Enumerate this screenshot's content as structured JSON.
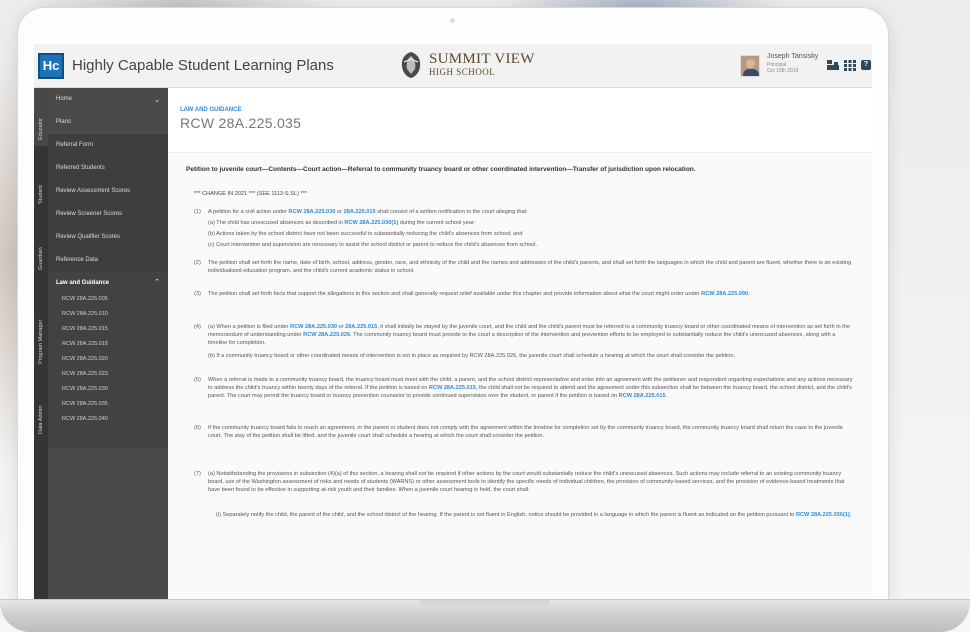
{
  "header": {
    "logo_text": "Hc",
    "app_title": "Highly Capable Student Learning Plans",
    "school_name": "SUMMIT VIEW",
    "school_sub": "HIGH SCHOOL",
    "user_name": "Joseph Tansisky",
    "user_role": "Principal",
    "user_date": "Oct 16th 2019"
  },
  "roles": [
    "Educator",
    "Student",
    "Guardian",
    "Program Manager",
    "Data Admin"
  ],
  "nav": {
    "items": [
      "Home",
      "Plans",
      "Referral Form",
      "Referred Students",
      "Review Assessment Scores",
      "Review Screener Scores",
      "Review Qualifier Scores",
      "Reference Data"
    ],
    "group_title": "Law and Guidance",
    "group_items": [
      "RCW 28A.225.005",
      "RCW 28A.225.010",
      "RCW 28A.225.015",
      "RCW 28A.225.018",
      "RCW 28A.225.020",
      "RCW 28A.225.023",
      "RCW 28A.225.030",
      "RCW 28A.225.035",
      "RCW 28A.225.040"
    ]
  },
  "content": {
    "category": "LAW AND GUIDANCE",
    "title": "RCW 28A.225.035",
    "heading": "Petition to juvenile court—Contents—Court action—Referral to community truancy board or other coordinated intervention—Transfer of jurisdiction upon relocation.",
    "change_note": "*** CHANGE IN 2021 *** (SEE 1113-S.SL) ***",
    "p1": {
      "num": "(1)",
      "a": "A petition for a civil action under ",
      "ref1": "RCW 28A.225.030",
      "b": " or ",
      "ref2": "28A.225.015",
      "c": " shall consist of a written notification to the court alleging that:",
      "sa_a": "(a) The child has unexcused absences as described in ",
      "sa_ref": "RCW 28A.225.030(1)",
      "sa_b": " during the current school year;",
      "sb": "(b) Actions taken by the school district have not been successful in substantially reducing the child's absences from school; and",
      "sc": "(c) Court intervention and supervision are necessary to assist the school district or parent to reduce the child's absences from school."
    },
    "p2": {
      "num": "(2)",
      "text": "The petition shall set forth the name, date of birth, school, address, gender, race, and ethnicity of the child and the names and addresses of the child's parents, and shall set forth the languages in which the child and parent are fluent, whether there is an existing individualized education program, and the child's current academic status in school."
    },
    "p3": {
      "num": "(3)",
      "a": "The petition shall set forth facts that support the allegations in this section and shall generally request relief available under this chapter and provide information about what the court might order under ",
      "ref": "RCW 28A.225.090",
      "b": "."
    },
    "p4": {
      "num": "(4)",
      "a": "(a) When a petition is filed under ",
      "ref1": "RCW 28A.225.030",
      "b": " or ",
      "ref2": "28A.225.015",
      "c": ", it shall initially be stayed by the juvenile court, and the child and the child's parent must be referred to a community truancy board or other coordinated means of intervention as set forth in the memorandum of understanding under ",
      "ref3": "RCW 28A.225.026",
      "d": ". The community truancy board must provide to the court a description of the intervention and prevention efforts to be employed to substantially reduce the child's unexcused absences, along with a timeline for completion.",
      "sb": "(b) If a community truancy board or other coordinated means of intervention is not in place as required by RCW 28A.225.026, the juvenile court shall schedule a hearing at which the court shall consider the petition."
    },
    "p5": {
      "num": "(5)",
      "a": "When a referral is made to a community truancy board, the truancy board must meet with the child, a parent, and the school district representative and enter into an agreement with the petitioner and respondent regarding expectations and any actions necessary to address the child's truancy within twenty days of the referral. If the petition is based on ",
      "ref1": "RCW 28A.225.015",
      "b": ", the child shall not be required to attend and the agreement under this subsection shall be between the truancy board, the school district, and the child's parent. The court may permit the truancy board or truancy prevention counselor to provide continued supervision over the student, or parent if the petition is based on ",
      "ref2": "RCW 28A.225.015",
      "c": "."
    },
    "p6": {
      "num": "(6)",
      "text": "If the community truancy board fails to reach an agreement, or the parent or student does not comply with the agreement within the timeline for completion set by the community truancy board, the community truancy board shall return the case to the juvenile court. The stay of the petition shall be lifted, and the juvenile court shall schedule a hearing at which the court shall consider the petition."
    },
    "p7": {
      "num": "(7)",
      "text": "(a) Notwithstanding the provisions in subsection (4)(a) of this section, a hearing shall not be required if other actions by the court would substantially reduce the child's unexcused absences. Such actions may include referral to an existing community truancy board, use of the Washington assessment of risks and needs of students (WARNS) or other assessment tools to identify the specific needs of individual children, the provision of community-based services, and the provision of evidence-based treatments that have been found to be effective in supporting at-risk youth and their families. When a juvenile court hearing is held, the court shall:",
      "si_a": "(i) Separately notify the child, the parent of the child, and the school district of the hearing. If the parent is not fluent in English, notice should be provided in a language in which the parent is fluent as indicated on the petition pursuant to ",
      "si_ref": "RCW 28A.225.030(1)",
      "si_b": ";"
    }
  }
}
